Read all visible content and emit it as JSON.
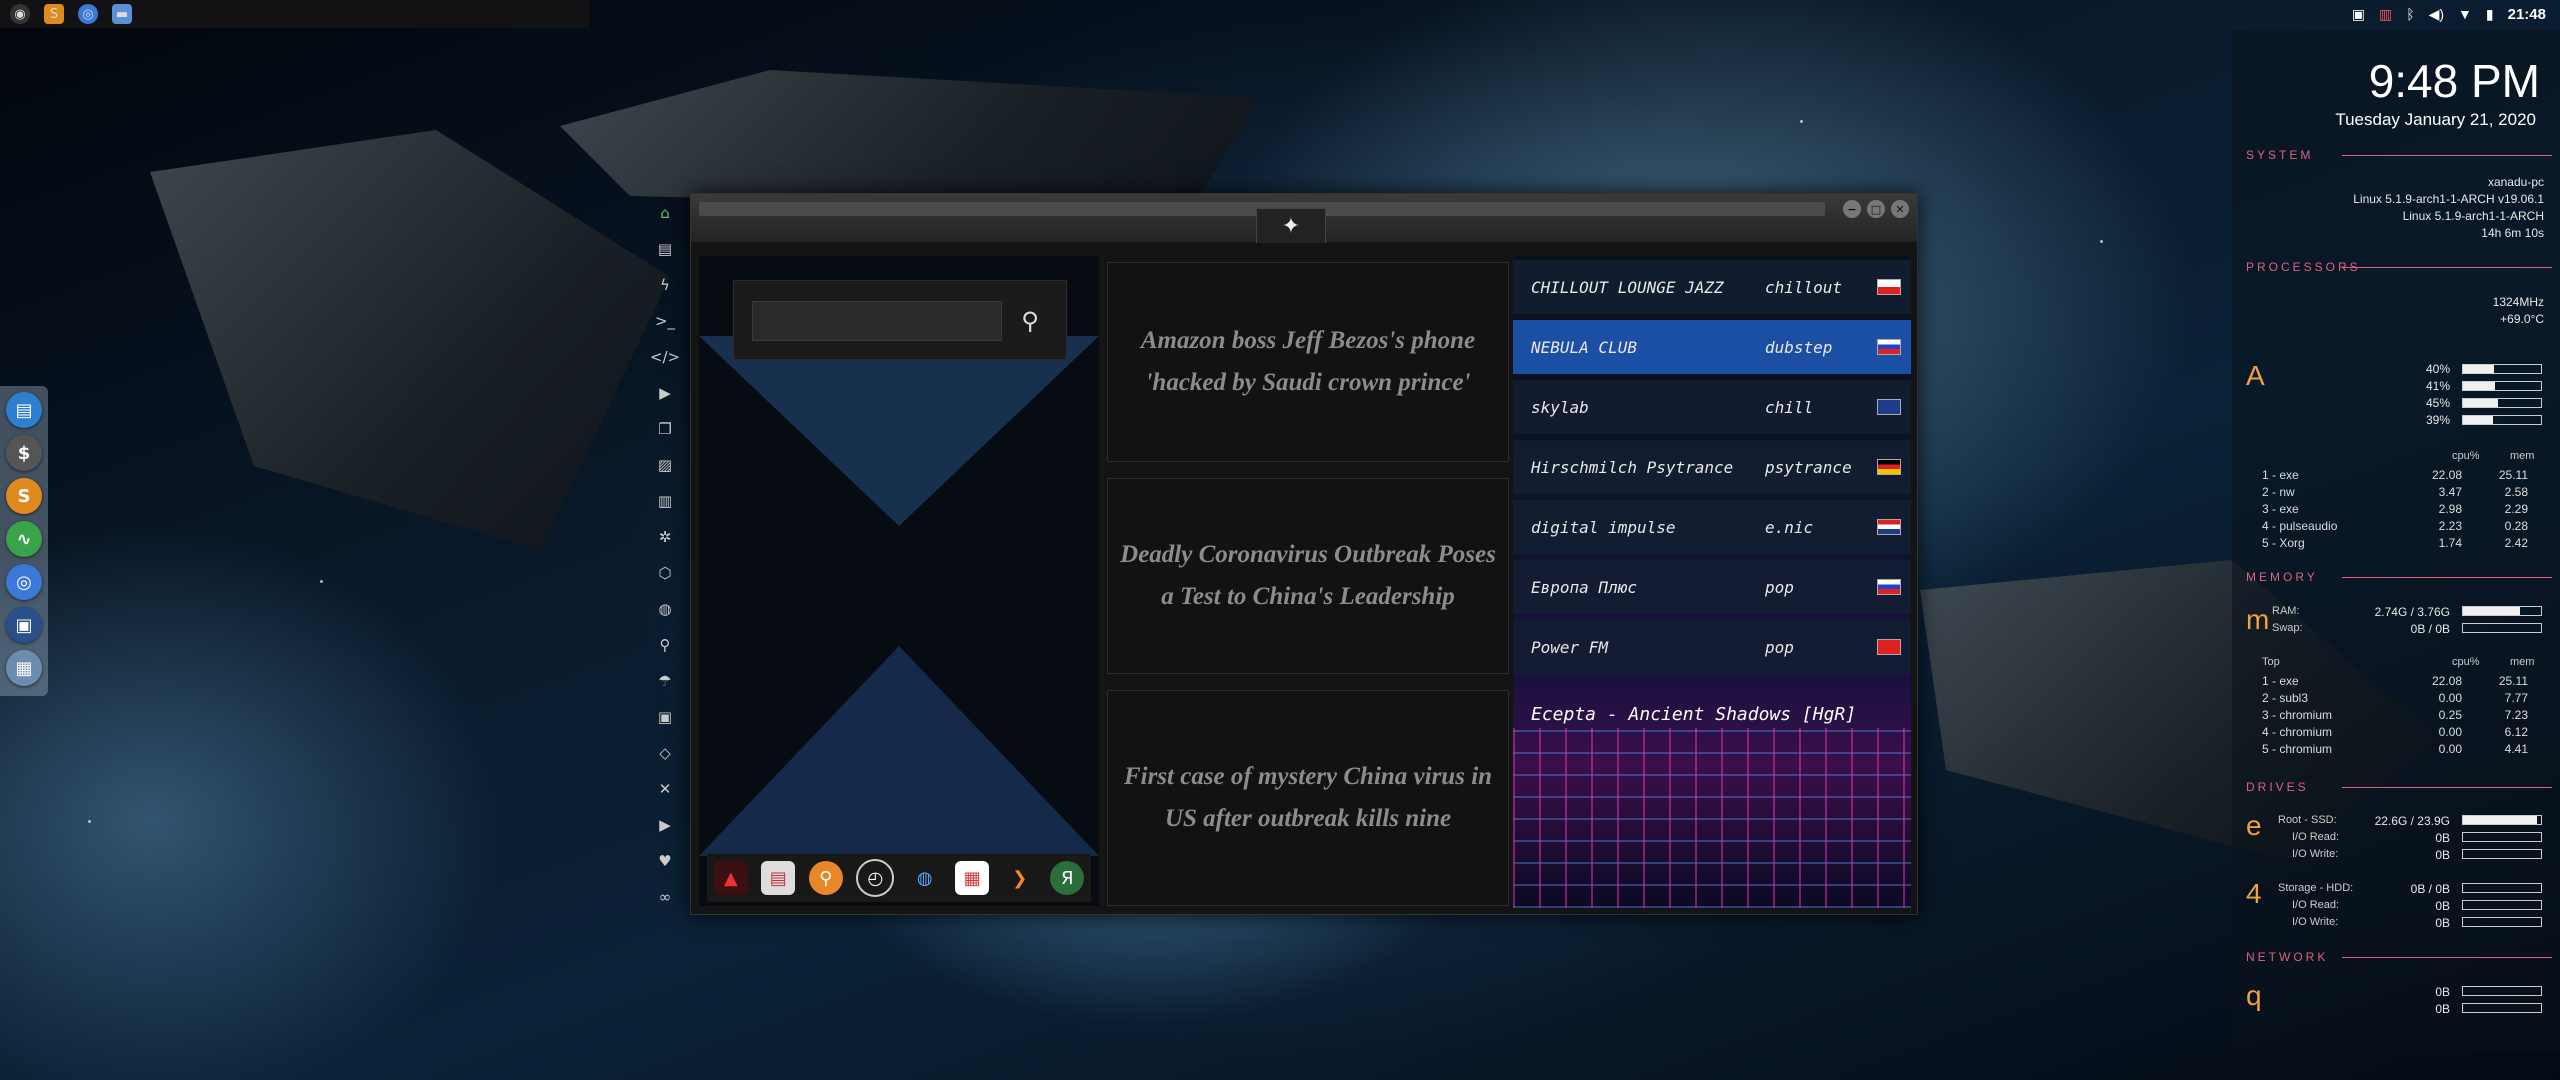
{
  "top_panel": {
    "apps": [
      "menu-icon",
      "sublime-icon",
      "chromium-icon",
      "files-icon"
    ],
    "clock": "21:48"
  },
  "window": {
    "search": {
      "placeholder": "",
      "value": ""
    },
    "news": [
      "Amazon boss Jeff Bezos's phone 'hacked by Saudi crown prince'",
      "Deadly Coronavirus Outbreak Poses a Test to China's Leadership",
      "First case of mystery China virus in US after outbreak kills nine"
    ],
    "stations": [
      {
        "name": "CHILLOUT LOUNGE JAZZ",
        "genre": "chillout",
        "flag": "pl"
      },
      {
        "name": "NEBULA CLUB",
        "genre": "dubstep",
        "flag": "ru"
      },
      {
        "name": "skylab",
        "genre": "chill",
        "flag": "gb"
      },
      {
        "name": "Hirschmilch Psytrance",
        "genre": "psytrance",
        "flag": "de"
      },
      {
        "name": "digital impulse",
        "genre": "e.nic",
        "flag": "hr"
      },
      {
        "name": "Европа Плюс",
        "genre": "pop",
        "flag": "ru"
      },
      {
        "name": "Power FM",
        "genre": "pop",
        "flag": "tr"
      }
    ],
    "now_playing": "Ecepta - Ancient Shadows [HgR]"
  },
  "conky": {
    "time": "9:48 PM",
    "date": "Tuesday January 21, 2020",
    "system_label": "SYSTEM",
    "hostname": "xanadu-pc",
    "kernel1": "Linux 5.1.9-arch1-1-ARCH v19.06.1",
    "kernel2": "Linux 5.1.9-arch1-1-ARCH",
    "uptime": "14h 6m 10s",
    "processors_label": "PROCESSORS",
    "freq": "1324MHz",
    "temp": "+69.0°C",
    "cpu_letter": "A",
    "cores": [
      "40%",
      "41%",
      "45%",
      "39%"
    ],
    "core_levels": [
      0.4,
      0.41,
      0.45,
      0.39
    ],
    "proc_header": {
      "cpu": "cpu%",
      "mem": "mem"
    },
    "cpu_top": [
      {
        "rank": "1 - exe",
        "cpu": "22.08",
        "mem": "25.11"
      },
      {
        "rank": "2 - nw",
        "cpu": "3.47",
        "mem": "2.58"
      },
      {
        "rank": "3 - exe",
        "cpu": "2.98",
        "mem": "2.29"
      },
      {
        "rank": "4 - pulseaudio",
        "cpu": "2.23",
        "mem": "0.28"
      },
      {
        "rank": "5 - Xorg",
        "cpu": "1.74",
        "mem": "2.42"
      }
    ],
    "memory_label": "MEMORY",
    "mem_letter": "m",
    "ram_label": "RAM:",
    "ram": "2.74G / 3.76G",
    "ram_level": 0.73,
    "swap_label": "Swap:",
    "swap": "0B / 0B",
    "mem_top_label": "Top",
    "mem_top": [
      {
        "rank": "1 - exe",
        "cpu": "22.08",
        "mem": "25.11"
      },
      {
        "rank": "2 - subl3",
        "cpu": "0.00",
        "mem": "7.77"
      },
      {
        "rank": "3 - chromium",
        "cpu": "0.25",
        "mem": "7.23"
      },
      {
        "rank": "4 - chromium",
        "cpu": "0.00",
        "mem": "6.12"
      },
      {
        "rank": "5 - chromium",
        "cpu": "0.00",
        "mem": "4.41"
      }
    ],
    "drives_label": "DRIVES",
    "root_letter": "e",
    "root_label": "Root - SSD:",
    "root": "22.6G / 23.9G",
    "root_level": 0.95,
    "io_read_label": "I/O Read:",
    "io_write_label": "I/O Write:",
    "root_read": "0B",
    "root_write": "0B",
    "storage_letter": "4",
    "storage_label": "Storage - HDD:",
    "storage": "0B / 0B",
    "storage_read": "0B",
    "storage_write": "0B",
    "network_label": "NETWORK",
    "net_letter": "q",
    "net_up": "0B",
    "net_down": "0B"
  },
  "colors": {
    "accent": "#e06080",
    "conky_big": "#f0a040",
    "selected_row": "#1b4fa3"
  }
}
